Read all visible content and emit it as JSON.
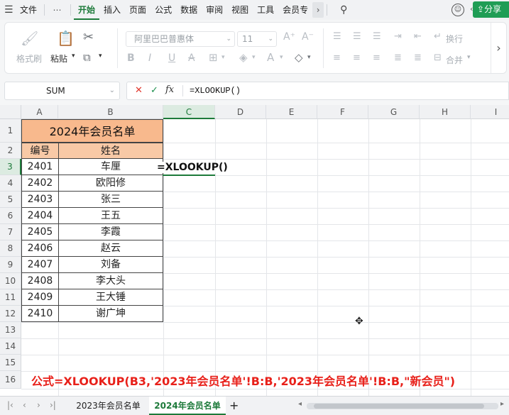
{
  "menu": {
    "items": [
      "文件",
      "开始",
      "插入",
      "页面",
      "公式",
      "数据",
      "审阅",
      "视图",
      "工具",
      "会员专"
    ],
    "active": "开始",
    "share_label": "分享"
  },
  "ribbon": {
    "format_painter": "格式刷",
    "paste": "粘贴",
    "font_name": "阿里巴巴普惠体",
    "font_size": "11",
    "wrap": "换行",
    "merge": "合并"
  },
  "formula_bar": {
    "name_box": "SUM",
    "formula": "=XLOOKUP()",
    "fx_label": "fx"
  },
  "columns": [
    "A",
    "B",
    "C",
    "D",
    "E",
    "F",
    "G",
    "H",
    "I"
  ],
  "rows": [
    "1",
    "2",
    "3",
    "4",
    "5",
    "6",
    "7",
    "8",
    "9",
    "10",
    "11",
    "12",
    "13",
    "14",
    "15",
    "16"
  ],
  "sheet": {
    "title": "2024年会员名单",
    "header_id": "编号",
    "header_name": "姓名",
    "members": [
      {
        "id": "2401",
        "name": "车厘"
      },
      {
        "id": "2402",
        "name": "欧阳修"
      },
      {
        "id": "2403",
        "name": "张三"
      },
      {
        "id": "2404",
        "name": "王五"
      },
      {
        "id": "2405",
        "name": "李霞"
      },
      {
        "id": "2406",
        "name": "赵云"
      },
      {
        "id": "2407",
        "name": "刘备"
      },
      {
        "id": "2408",
        "name": "李大头"
      },
      {
        "id": "2409",
        "name": "王大锤"
      },
      {
        "id": "2410",
        "name": "谢广坤"
      }
    ],
    "editing_text": "=XLOOKUP()",
    "note": "公式=XLOOKUP(B3,'2023年会员名单'!B:B,'2023年会员名单'!B:B,\"新会员\")"
  },
  "tabs": [
    "2023年会员名单",
    "2024年会员名单"
  ],
  "active_tab": "2024年会员名单",
  "colors": {
    "accent": "#1d7a3a",
    "title_fill": "#f8b98d",
    "header_fill": "#f8c9a6",
    "note": "#e8201a"
  }
}
